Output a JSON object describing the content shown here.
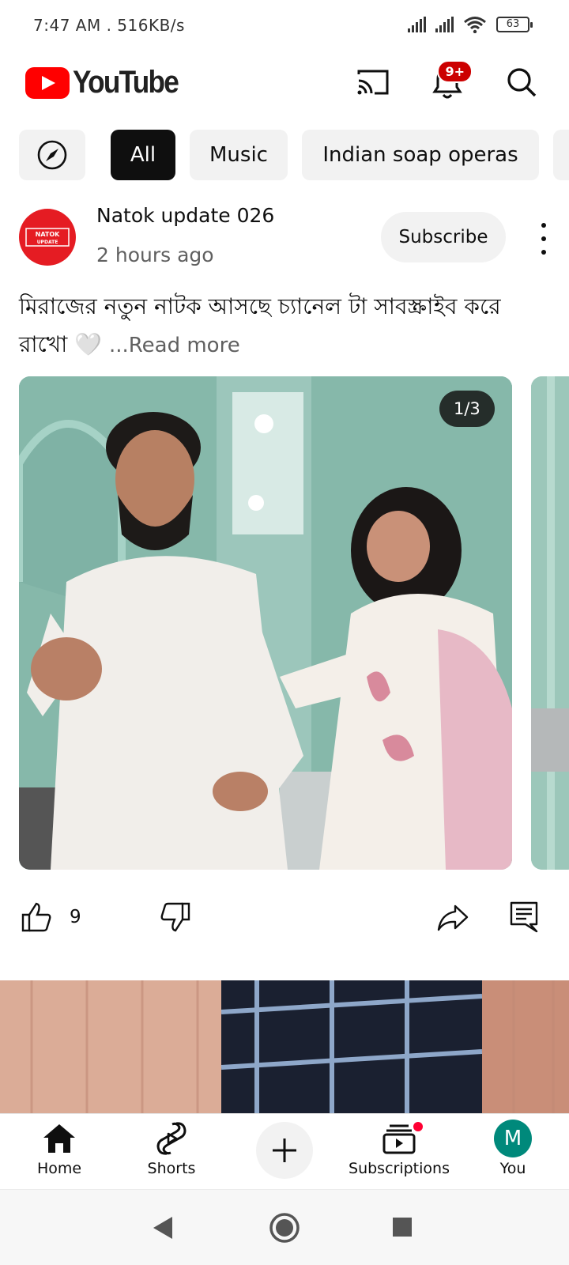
{
  "status_bar": {
    "time": "7:47 AM",
    "speed": ". 516KB/s",
    "battery": "63"
  },
  "header": {
    "logo_text": "YouTube",
    "notification_badge": "9+",
    "icons": [
      "cast-icon",
      "bell-icon",
      "search-icon"
    ]
  },
  "chips": {
    "explore_icon": "compass-icon",
    "items": [
      {
        "label": "All",
        "selected": true
      },
      {
        "label": "Music",
        "selected": false
      },
      {
        "label": "Indian soap operas",
        "selected": false
      }
    ]
  },
  "post": {
    "avatar_text": "NATOK UPDATE",
    "channel_name": "Natok update 026",
    "time": "2 hours ago",
    "subscribe_label": "Subscribe",
    "text": "মিরাজের নতুন নাটক আসছে চ্যানেল টা সাবস্ক্রাইব করে রাখো 🤍",
    "read_more": "...Read more",
    "image_counter": "1/3",
    "like_count": "9"
  },
  "bottom_nav": {
    "items": [
      {
        "label": "Home",
        "icon": "home-icon"
      },
      {
        "label": "Shorts",
        "icon": "shorts-icon"
      },
      {
        "label": "",
        "icon": "plus-icon"
      },
      {
        "label": "Subscriptions",
        "icon": "subscriptions-icon"
      },
      {
        "label": "You",
        "icon": "avatar"
      }
    ],
    "you_initial": "M"
  },
  "colors": {
    "brand_red": "#ff0000",
    "badge_red": "#cc0000",
    "avatar_teal": "#00897b",
    "chip_bg": "#f2f2f2",
    "chip_active": "#0f0f0f"
  }
}
